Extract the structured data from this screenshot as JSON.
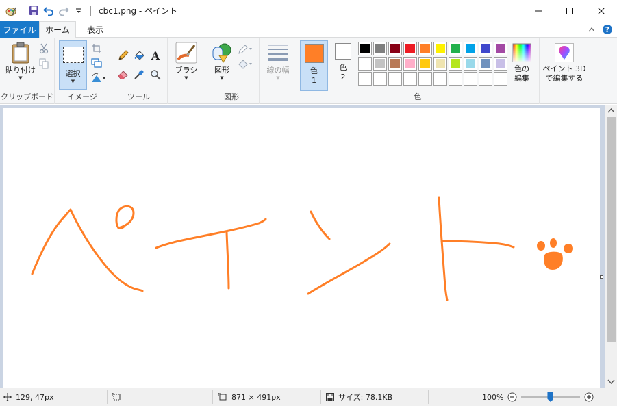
{
  "titlebar": {
    "title": "cbc1.png - ペイント",
    "icons": [
      "paint-app-icon",
      "save-icon",
      "undo-icon",
      "redo-icon",
      "customize-qat-icon"
    ]
  },
  "tabs": {
    "file": "ファイル",
    "home": "ホーム",
    "view": "表示"
  },
  "clipboard": {
    "paste": "貼り付け",
    "label": "クリップボード"
  },
  "image": {
    "select": "選択",
    "label": "イメージ"
  },
  "tools": {
    "label": "ツール"
  },
  "brushes": {
    "label": "ブラシ"
  },
  "shapes": {
    "shapes_btn": "図形",
    "label": "図形"
  },
  "size": {
    "label": "線の幅"
  },
  "colors": {
    "color1_label": "色",
    "color1_num": "1",
    "color2_label": "色",
    "color2_num": "2",
    "edit_line1": "色の",
    "edit_line2": "編集",
    "label": "色",
    "color1": "#ff7f27",
    "color2": "#ffffff",
    "palette_row1": [
      "#000000",
      "#7f7f7f",
      "#880015",
      "#ed1c24",
      "#ff7f27",
      "#fff200",
      "#22b14c",
      "#00a2e8",
      "#3f48cc",
      "#a349a4"
    ],
    "palette_row2": [
      "#ffffff",
      "#c3c3c3",
      "#b97a57",
      "#ffaec9",
      "#ffc90e",
      "#efe4b0",
      "#b5e61d",
      "#99d9ea",
      "#7092be",
      "#c8bfe7"
    ]
  },
  "paint3d": {
    "line1": "ペイント 3D",
    "line2": "で編集する"
  },
  "canvas": {
    "stroke_color": "#ff7f27"
  },
  "status": {
    "cursor_pos": "129, 47px",
    "image_size": "871 × 491px",
    "file_size": "サイズ: 78.1KB",
    "zoom": "100%"
  }
}
